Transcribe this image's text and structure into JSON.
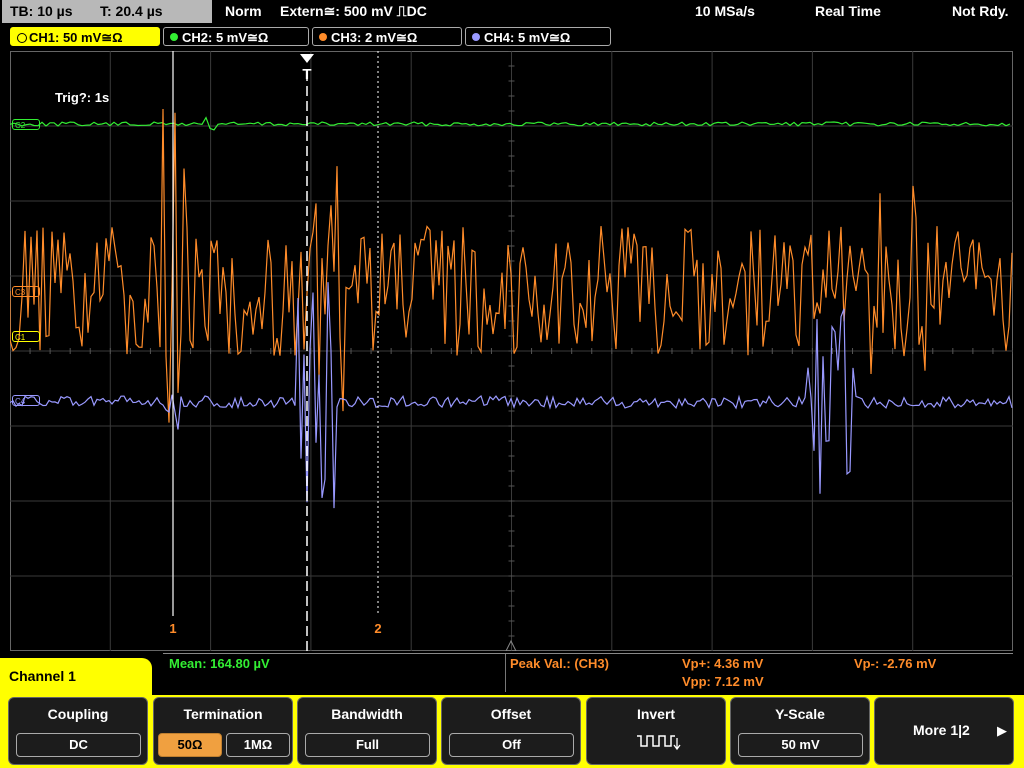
{
  "status": {
    "timebase": "TB: 10 µs",
    "trigger_pos": "T: 20.4 µs",
    "mode": "Norm",
    "trigger_source": "Extern≅: 500 mV ⎍DC",
    "sample_rate": "10 MSa/s",
    "acq_mode": "Real Time",
    "ready_state": "Not Rdy."
  },
  "channels": [
    {
      "label": "CH1: 50 mV≅Ω",
      "color": "#ffff00",
      "active": true
    },
    {
      "label": "CH2: 5 mV≅Ω",
      "color": "#33ee33",
      "active": false
    },
    {
      "label": "CH3: 2 mV≅Ω",
      "color": "#ff8c2a",
      "active": false
    },
    {
      "label": "CH4: 5 mV≅Ω",
      "color": "#9999ff",
      "active": false
    }
  ],
  "trigger_info": "Trig?: 1s",
  "cursor_labels": {
    "c1": "1",
    "c2": "2",
    "trigger": "T"
  },
  "markers": {
    "ch1": "C1",
    "ch2": "C2",
    "ch3": "C3",
    "ch4": "C4"
  },
  "measurements": {
    "mean": "Mean: 164.80 µV",
    "peak_label": "Peak Val.: (CH3)",
    "vp_plus": "Vp+: 4.36 mV",
    "vpp": "Vpp: 7.12 mV",
    "vp_minus": "Vp-: -2.76 mV"
  },
  "menu_title": "Channel 1",
  "softkeys": {
    "coupling": {
      "title": "Coupling",
      "value": "DC"
    },
    "termination": {
      "title": "Termination",
      "opt1": "50Ω",
      "opt2": "1MΩ"
    },
    "bandwidth": {
      "title": "Bandwidth",
      "value": "Full"
    },
    "offset": {
      "title": "Offset",
      "value": "Off"
    },
    "invert": {
      "title": "Invert"
    },
    "yscale": {
      "title": "Y-Scale",
      "value": "50 mV"
    },
    "more": {
      "title": "More 1|2"
    }
  },
  "colors": {
    "ch1": "#ffff00",
    "ch2": "#33ee33",
    "ch3": "#ff8c2a",
    "ch4": "#9999ff",
    "cursor": "#ff8c2a"
  }
}
